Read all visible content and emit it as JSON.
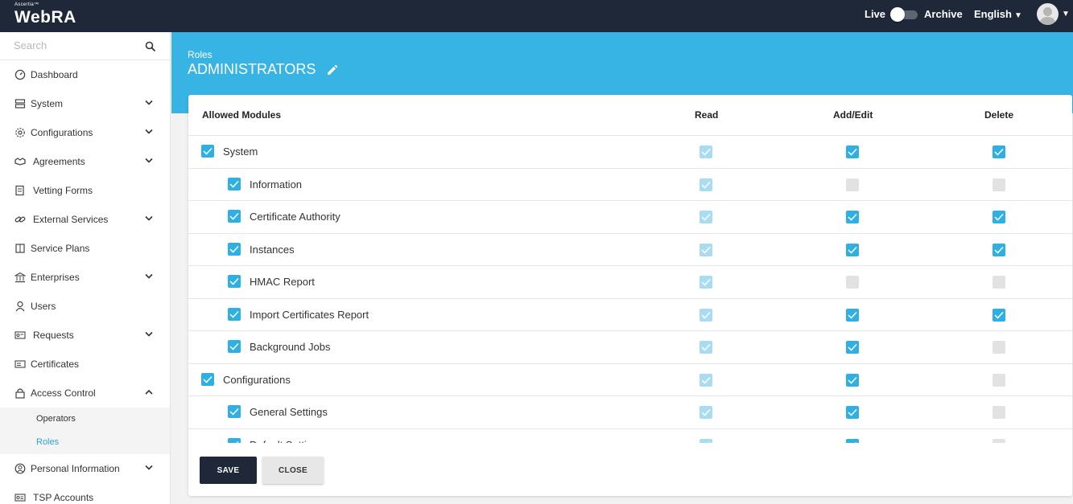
{
  "brand": {
    "small": "Ascertia™",
    "name": "WebRA"
  },
  "header": {
    "mode_live": "Live",
    "mode_archive": "Archive",
    "language": "English"
  },
  "sidebar": {
    "search_placeholder": "Search",
    "items": [
      {
        "label": "Dashboard",
        "icon": "dashboard-icon",
        "expandable": false
      },
      {
        "label": "System",
        "icon": "server-icon",
        "expandable": true
      },
      {
        "label": "Configurations",
        "icon": "gear-icon",
        "expandable": true
      },
      {
        "label": "Agreements",
        "icon": "handshake-icon",
        "expandable": true
      },
      {
        "label": "Vetting Forms",
        "icon": "form-icon",
        "expandable": false
      },
      {
        "label": "External Services",
        "icon": "link-icon",
        "expandable": true
      },
      {
        "label": "Service Plans",
        "icon": "plans-icon",
        "expandable": false
      },
      {
        "label": "Enterprises",
        "icon": "bank-icon",
        "expandable": true
      },
      {
        "label": "Users",
        "icon": "user-icon",
        "expandable": false
      },
      {
        "label": "Requests",
        "icon": "requests-icon",
        "expandable": true
      },
      {
        "label": "Certificates",
        "icon": "certificate-icon",
        "expandable": false
      },
      {
        "label": "Access Control",
        "icon": "lock-icon",
        "expandable": true,
        "expanded": true
      },
      {
        "label": "Personal Information",
        "icon": "profile-icon",
        "expandable": true
      },
      {
        "label": "TSP Accounts",
        "icon": "account-icon",
        "expandable": false
      }
    ],
    "access_control_sub": [
      {
        "label": "Operators",
        "active": false
      },
      {
        "label": "Roles",
        "active": true
      }
    ]
  },
  "page": {
    "breadcrumb": "Roles",
    "title": "ADMINISTRATORS"
  },
  "table": {
    "headers": {
      "module": "Allowed Modules",
      "read": "Read",
      "add_edit": "Add/Edit",
      "delete": "Delete"
    },
    "rows": [
      {
        "label": "System",
        "level": 0,
        "read": "lite",
        "add_edit": "on",
        "delete": "on"
      },
      {
        "label": "Information",
        "level": 1,
        "read": "lite",
        "add_edit": "off",
        "delete": "off"
      },
      {
        "label": "Certificate Authority",
        "level": 1,
        "read": "lite",
        "add_edit": "on",
        "delete": "on"
      },
      {
        "label": "Instances",
        "level": 1,
        "read": "lite",
        "add_edit": "on",
        "delete": "on"
      },
      {
        "label": "HMAC Report",
        "level": 1,
        "read": "lite",
        "add_edit": "off",
        "delete": "off"
      },
      {
        "label": "Import Certificates Report",
        "level": 1,
        "read": "lite",
        "add_edit": "on",
        "delete": "on"
      },
      {
        "label": "Background Jobs",
        "level": 1,
        "read": "lite",
        "add_edit": "on",
        "delete": "off"
      },
      {
        "label": "Configurations",
        "level": 0,
        "read": "lite",
        "add_edit": "on",
        "delete": "off"
      },
      {
        "label": "General Settings",
        "level": 1,
        "read": "lite",
        "add_edit": "on",
        "delete": "off"
      },
      {
        "label": "Default Settings",
        "level": 1,
        "read": "lite",
        "add_edit": "on",
        "delete": "off"
      }
    ]
  },
  "buttons": {
    "save": "SAVE",
    "close": "CLOSE"
  },
  "colors": {
    "accent": "#37b3e4",
    "navy": "#1e2838",
    "checkbox_on": "#2fb0e5",
    "checkbox_disabled": "#a9dcf2",
    "checkbox_off": "#e2e2e2"
  }
}
